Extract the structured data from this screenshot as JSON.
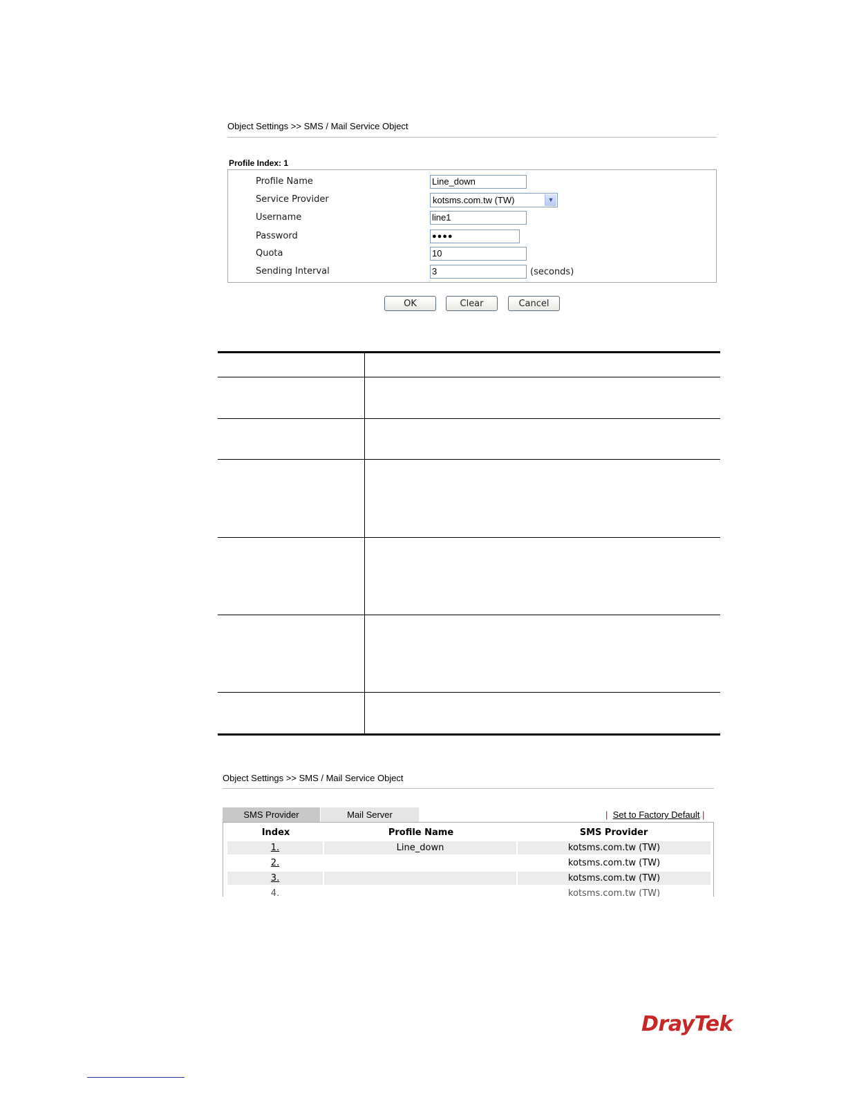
{
  "top": {
    "breadcrumb": "Object Settings >> SMS / Mail Service Object",
    "profile_index": "Profile Index: 1",
    "fields": {
      "profile_name": {
        "label": "Profile Name",
        "value": "Line_down"
      },
      "service_provider": {
        "label": "Service Provider",
        "value": "kotsms.com.tw (TW)"
      },
      "username": {
        "label": "Username",
        "value": "line1"
      },
      "password": {
        "label": "Password",
        "value": "●●●●"
      },
      "quota": {
        "label": "Quota",
        "value": "10"
      },
      "sending_interval": {
        "label": "Sending Interval",
        "value": "3",
        "unit": "(seconds)"
      }
    },
    "buttons": {
      "ok": "OK",
      "clear": "Clear",
      "cancel": "Cancel"
    }
  },
  "bottom": {
    "breadcrumb": "Object Settings >> SMS / Mail Service Object",
    "tabs": {
      "sms": "SMS Provider",
      "mail": "Mail Server"
    },
    "factory_sep": "|",
    "factory_default": "Set to Factory Default",
    "columns": {
      "index": "Index",
      "profile_name": "Profile Name",
      "sms_provider": "SMS Provider"
    },
    "rows": [
      {
        "index": "1.",
        "profile_name": "Line_down",
        "sms_provider": "kotsms.com.tw (TW)"
      },
      {
        "index": "2.",
        "profile_name": "",
        "sms_provider": "kotsms.com.tw (TW)"
      },
      {
        "index": "3.",
        "profile_name": "",
        "sms_provider": "kotsms.com.tw (TW)"
      },
      {
        "index": "4.",
        "profile_name": "",
        "sms_provider": "kotsms.com.tw (TW)"
      }
    ]
  },
  "footer": {
    "logo_part1": "Dray",
    "logo_part2": "Tek"
  },
  "colors": {
    "logo_red": "#c62828",
    "accent_pink": "#c00060",
    "footer_line": "#1a3a8f"
  }
}
